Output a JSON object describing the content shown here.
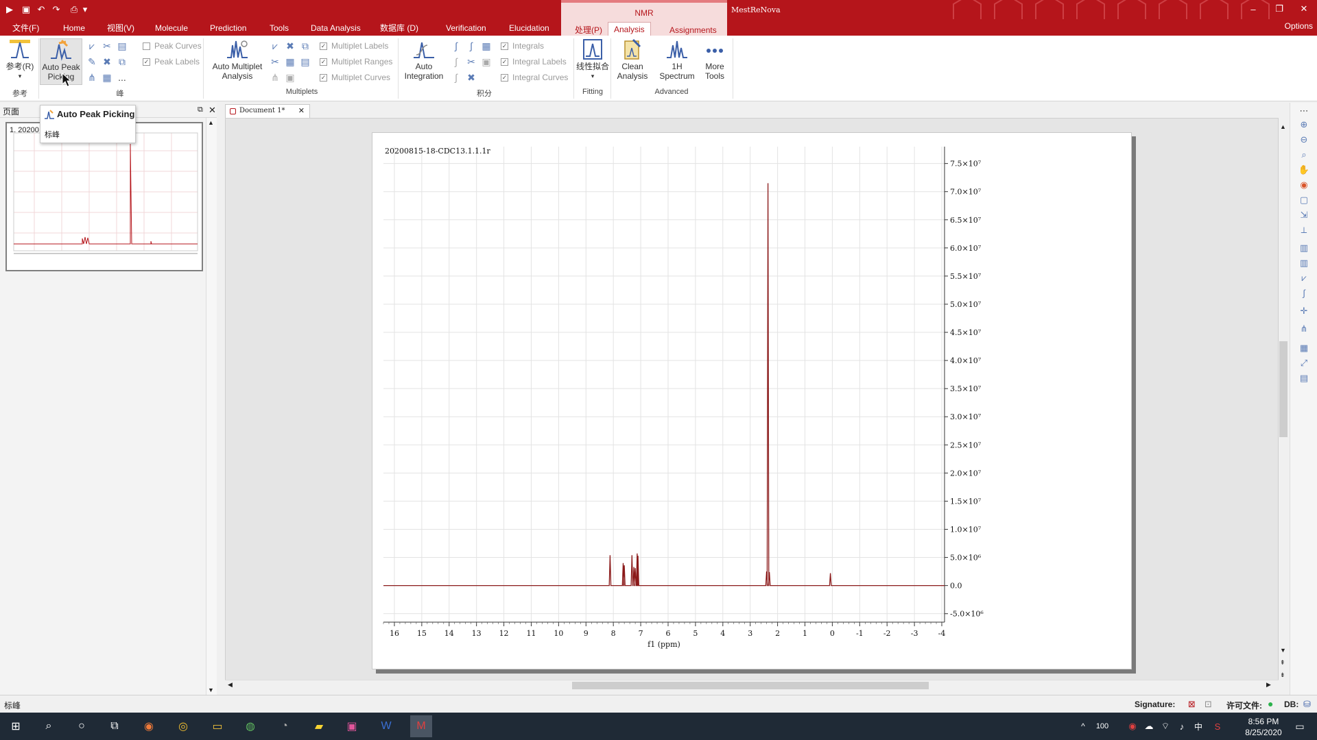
{
  "app": {
    "title": "MestReNova",
    "context_tab_label": "NMR",
    "options_label": "Options"
  },
  "menu_tabs": [
    {
      "label": "文件(F)"
    },
    {
      "label": "Home"
    },
    {
      "label": "视图(V)"
    },
    {
      "label": "Molecule"
    },
    {
      "label": "Prediction"
    },
    {
      "label": "Tools"
    },
    {
      "label": "Data Analysis"
    },
    {
      "label": "数据库 (D)"
    },
    {
      "label": "Verification"
    },
    {
      "label": "Elucidation"
    },
    {
      "label": "处理(P)"
    },
    {
      "label": "Analysis"
    },
    {
      "label": "Assignments"
    }
  ],
  "ribbon": {
    "reference_label": "参考(R)",
    "reference_group": "参考",
    "auto_peak_label_1": "Auto Peak",
    "auto_peak_label_2": "Picking",
    "peaks_group": "峰",
    "peak_curves": "Peak Curves",
    "peak_labels": "Peak Labels",
    "auto_multiplet_label_1": "Auto Multiplet",
    "auto_multiplet_label_2": "Analysis",
    "multiplet_labels": "Multiplet Labels",
    "multiplet_ranges": "Multiplet Ranges",
    "multiplet_curves": "Multiplet Curves",
    "multiplets_group": "Multiplets",
    "auto_integration_label_1": "Auto",
    "auto_integration_label_2": "Integration",
    "integrals": "Integrals",
    "integral_labels": "Integral Labels",
    "integral_curves": "Integral Curves",
    "integration_group": "积分",
    "line_fit_label": "线性拟合",
    "fitting_group": "Fitting",
    "clean_label_1": "Clean",
    "clean_label_2": "Analysis",
    "spectrum_label_1": "1H",
    "spectrum_label_2": "Spectrum",
    "more_label_1": "More",
    "more_label_2": "Tools",
    "advanced_group": "Advanced",
    "more_dots": "..."
  },
  "left_panel": {
    "title": "页面",
    "thumb_label": "1. 20200"
  },
  "tooltip": {
    "title": "Auto Peak Picking",
    "desc": "标峰"
  },
  "document": {
    "tab_label": "Document 1*"
  },
  "chart_data": {
    "type": "line",
    "title": "20200815-18-CDC13.1.1.1r",
    "xlabel": "f1 (ppm)",
    "ylabel": "",
    "xlim": [
      16.4,
      -4.1
    ],
    "ylim": [
      -6500000,
      78000000
    ],
    "x_ticks": [
      16,
      15,
      14,
      13,
      12,
      11,
      10,
      9,
      8,
      7,
      6,
      5,
      4,
      3,
      2,
      1,
      0,
      -1,
      -2,
      -3,
      -4
    ],
    "y_ticks": [
      {
        "value": 75000000,
        "label": "7.5×10⁷"
      },
      {
        "value": 70000000,
        "label": "7.0×10⁷"
      },
      {
        "value": 65000000,
        "label": "6.5×10⁷"
      },
      {
        "value": 60000000,
        "label": "6.0×10⁷"
      },
      {
        "value": 55000000,
        "label": "5.5×10⁷"
      },
      {
        "value": 50000000,
        "label": "5.0×10⁷"
      },
      {
        "value": 45000000,
        "label": "4.5×10⁷"
      },
      {
        "value": 40000000,
        "label": "4.0×10⁷"
      },
      {
        "value": 35000000,
        "label": "3.5×10⁷"
      },
      {
        "value": 30000000,
        "label": "3.0×10⁷"
      },
      {
        "value": 25000000,
        "label": "2.5×10⁷"
      },
      {
        "value": 20000000,
        "label": "2.0×10⁷"
      },
      {
        "value": 15000000,
        "label": "1.5×10⁷"
      },
      {
        "value": 10000000,
        "label": "1.0×10⁷"
      },
      {
        "value": 5000000,
        "label": "5.0×10⁶"
      },
      {
        "value": 0,
        "label": "0.0"
      },
      {
        "value": -5000000,
        "label": "-5.0×10⁶"
      }
    ],
    "peaks": [
      {
        "ppm": 8.12,
        "height": 5400000
      },
      {
        "ppm": 7.64,
        "height": 4000000
      },
      {
        "ppm": 7.6,
        "height": 3600000
      },
      {
        "ppm": 7.32,
        "height": 5400000
      },
      {
        "ppm": 7.25,
        "height": 3300000
      },
      {
        "ppm": 7.2,
        "height": 3100000
      },
      {
        "ppm": 7.13,
        "height": 5700000
      },
      {
        "ppm": 7.1,
        "height": 5300000
      },
      {
        "ppm": 2.4,
        "height": 2500000
      },
      {
        "ppm": 2.35,
        "height": 71500000
      },
      {
        "ppm": 2.3,
        "height": 2400000
      },
      {
        "ppm": 0.07,
        "height": 2200000
      }
    ],
    "grid": true,
    "line_color": "#8b1a1a"
  },
  "status": {
    "text": "标峰",
    "signature_label": "Signature:",
    "license_label": "许可文件:",
    "db_label": "DB:"
  },
  "taskbar": {
    "tray_num": "100",
    "ime_label": "中",
    "time": "8:56 PM",
    "date": "8/25/2020"
  }
}
